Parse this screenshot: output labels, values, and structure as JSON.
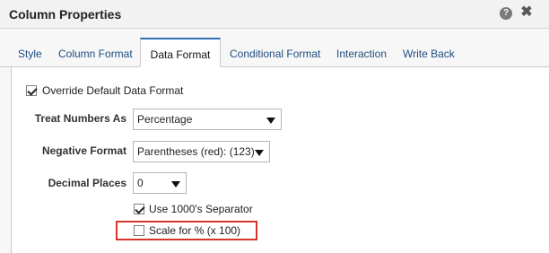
{
  "dialog": {
    "title": "Column Properties",
    "help_icon_glyph": "?",
    "close_icon_glyph": "✖"
  },
  "tabs": [
    {
      "label": "Style"
    },
    {
      "label": "Column Format"
    },
    {
      "label": "Data Format"
    },
    {
      "label": "Conditional Format"
    },
    {
      "label": "Interaction"
    },
    {
      "label": "Write Back"
    }
  ],
  "active_tab": "Data Format",
  "form": {
    "override": {
      "label": "Override Default Data Format",
      "checked": true
    },
    "treat_numbers_as": {
      "label": "Treat Numbers As",
      "value": "Percentage"
    },
    "negative_format": {
      "label": "Negative Format",
      "value": "Parentheses (red): (123)"
    },
    "decimal_places": {
      "label": "Decimal Places",
      "value": "0"
    },
    "use_separator": {
      "label": "Use 1000's Separator",
      "checked": true
    },
    "scale_percent": {
      "label": "Scale for % (x 100)",
      "checked": false
    }
  },
  "colors": {
    "active_tab_border": "#2f6cb0",
    "tab_text": "#1e4d80",
    "highlight_box": "#d9342b"
  }
}
